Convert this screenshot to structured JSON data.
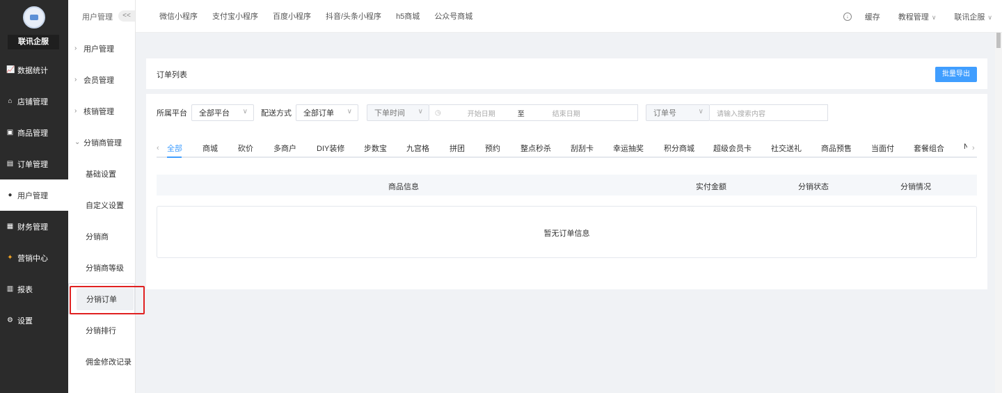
{
  "sidebar": {
    "brand": "联讯企服",
    "items": [
      {
        "label": "数据统计",
        "icon": "chart-icon"
      },
      {
        "label": "店铺管理",
        "icon": "store-icon"
      },
      {
        "label": "商品管理",
        "icon": "goods-icon"
      },
      {
        "label": "订单管理",
        "icon": "order-icon"
      },
      {
        "label": "用户管理",
        "icon": "user-icon"
      },
      {
        "label": "财务管理",
        "icon": "finance-icon"
      },
      {
        "label": "营销中心",
        "icon": "marketing-icon"
      },
      {
        "label": "报表",
        "icon": "report-icon"
      },
      {
        "label": "设置",
        "icon": "settings-icon"
      }
    ]
  },
  "subnav": {
    "title": "用户管理",
    "collapse": "<<",
    "groups": [
      "用户管理",
      "会员管理",
      "核销管理",
      "分销商管理"
    ],
    "children": [
      "基础设置",
      "自定义设置",
      "分销商",
      "分销商等级",
      "分销订单",
      "分销排行",
      "佣金修改记录"
    ]
  },
  "topnav": {
    "tabs": [
      "微信小程序",
      "支付宝小程序",
      "百度小程序",
      "抖音/头条小程序",
      "h5商城",
      "公众号商城"
    ],
    "cache": "缓存",
    "tutorial": "教程管理",
    "account": "联讯企服"
  },
  "page": {
    "title": "订单列表",
    "export": "批量导出"
  },
  "filters": {
    "platform_label": "所属平台",
    "platform_value": "全部平台",
    "delivery_label": "配送方式",
    "delivery_value": "全部订单",
    "time_type": "下单时间",
    "start_placeholder": "开始日期",
    "range_sep": "至",
    "end_placeholder": "结束日期",
    "search_type": "订单号",
    "search_placeholder": "请输入搜索内容"
  },
  "categories": [
    "全部",
    "商城",
    "砍价",
    "多商户",
    "DIY装修",
    "步数宝",
    "九宫格",
    "拼团",
    "预约",
    "整点秒杀",
    "刮刮卡",
    "幸运抽奖",
    "积分商城",
    "超级会员卡",
    "社交送礼",
    "商品预售",
    "当面付",
    "套餐组合",
    "N"
  ],
  "table": {
    "headers": [
      "商品信息",
      "实付金额",
      "分销状态",
      "分销情况"
    ],
    "empty": "暂无订单信息"
  }
}
